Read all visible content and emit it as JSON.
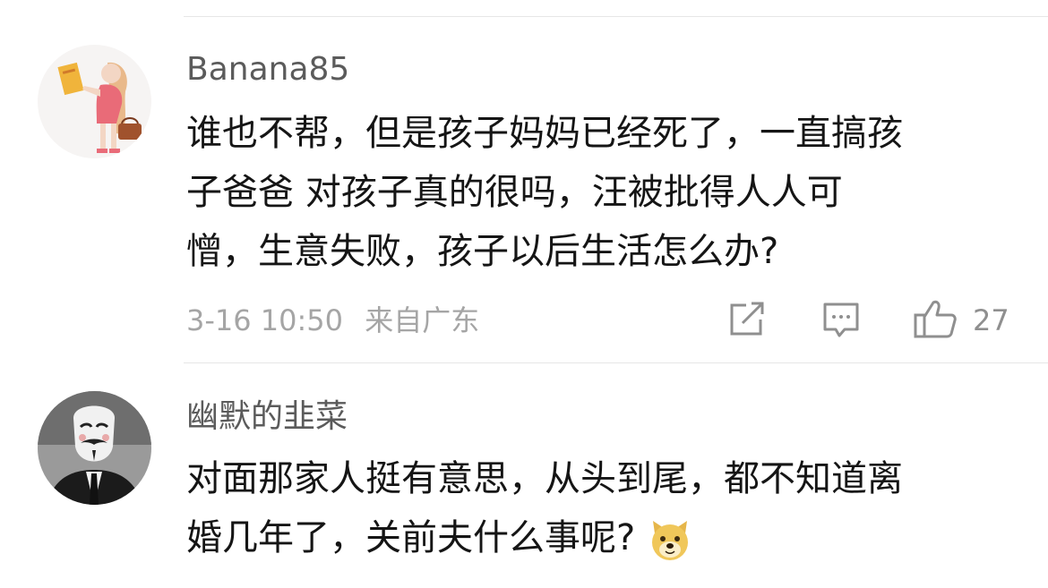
{
  "comments": [
    {
      "username": "Banana85",
      "lines": [
        "谁也不帮，但是孩子妈妈已经死了，一直搞孩",
        "子爸爸 对孩子真的很吗，汪被批得人人可",
        "憎，生意失败，孩子以后生活怎么办?"
      ],
      "timestamp": "3-16 10:50",
      "location": "来自广东",
      "likes": "27",
      "avatar_icon": "woman-reading-icon"
    },
    {
      "username": "幽默的韭菜",
      "lines": [
        "对面那家人挺有意思，从头到尾，都不知道离",
        "婚几年了，关前夫什么事呢?"
      ],
      "emoji_icon": "doge-emoji-icon",
      "avatar_icon": "guy-fawkes-mask-icon"
    }
  ],
  "colors": {
    "username": "#5b5b5b",
    "text": "#151515",
    "meta": "#a5a5a5",
    "icon": "#8f8f8f",
    "divider": "#e6e6e6"
  }
}
